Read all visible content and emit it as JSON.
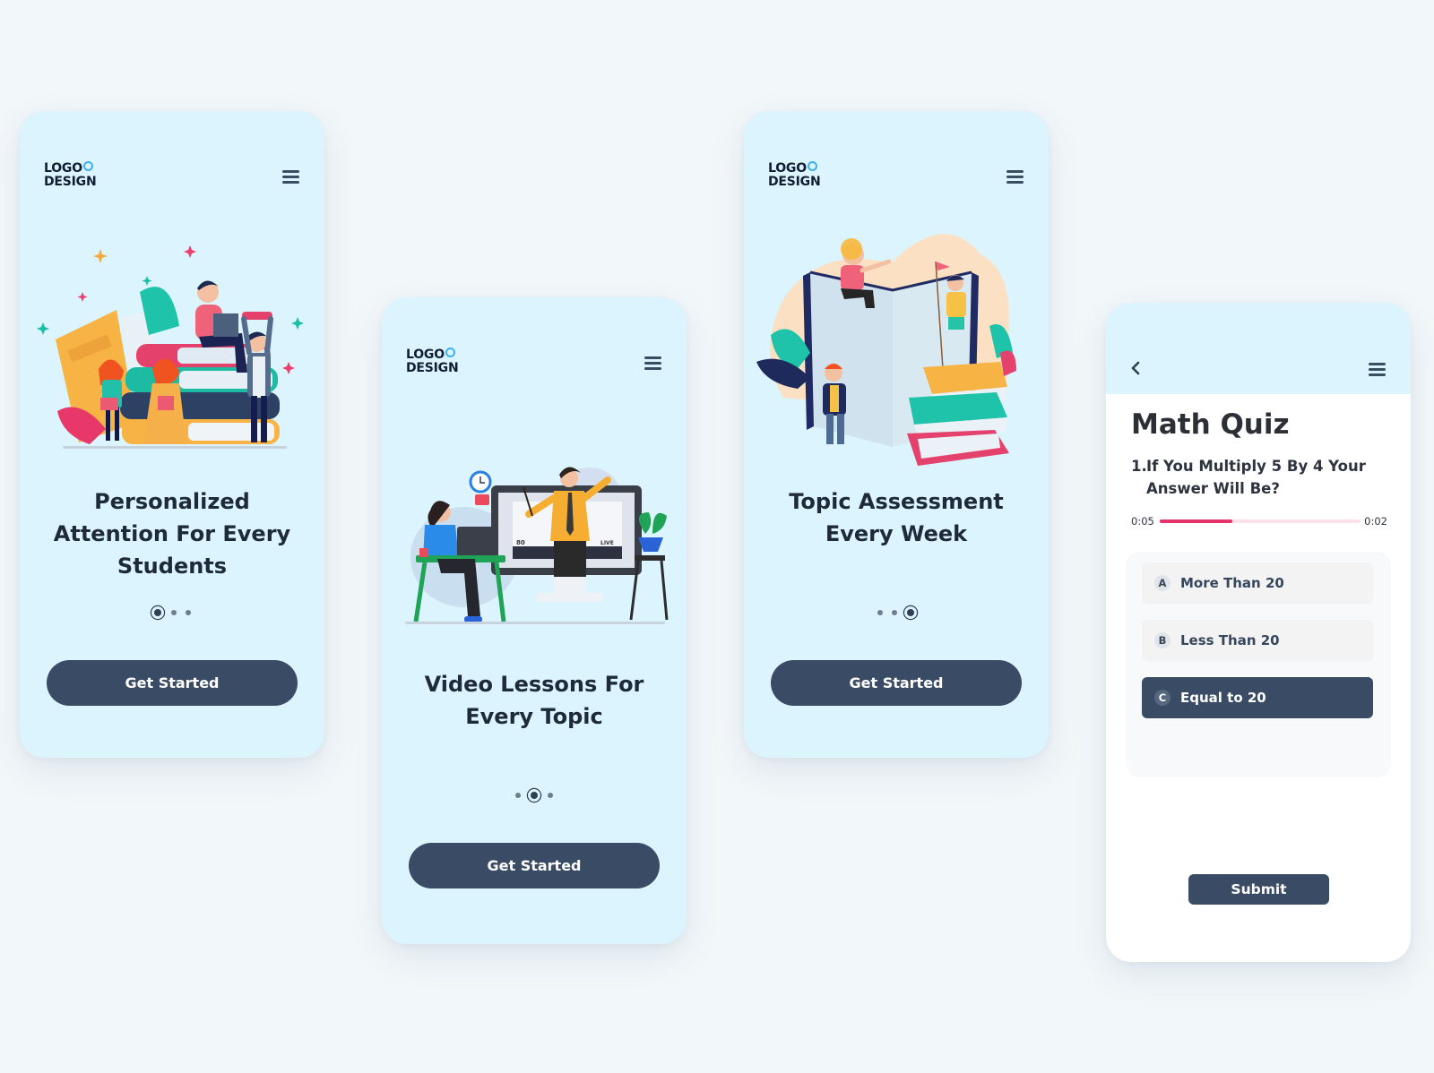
{
  "brand": {
    "logo_line1": "LOGO",
    "logo_line2": "DESIGN",
    "accent": "#3fb1f3"
  },
  "screens": [
    {
      "title": "Personalized Attention For Every Students",
      "illustration": "students-reading-books-illustration",
      "dots_total": 3,
      "dots_active": 1,
      "cta": "Get Started"
    },
    {
      "title": "Video Lessons For Every  Topic",
      "illustration": "online-video-lesson-illustration",
      "dots_total": 3,
      "dots_active": 2,
      "cta": "Get Started",
      "video_overlay": {
        "viewers": "80",
        "live": "LIVE"
      }
    },
    {
      "title": "Topic Assessment Every Week",
      "illustration": "kids-on-giant-book-illustration",
      "dots_total": 3,
      "dots_active": 3,
      "cta": "Get Started"
    }
  ],
  "quiz": {
    "title": "Math Quiz",
    "question_number": "1.",
    "question": "If You Multiply 5 By 4 Your Answer Will Be?",
    "timer_left": "0:05",
    "timer_right": "0:02",
    "progress_fraction": 0.36,
    "options": [
      {
        "letter": "A",
        "label": "More Than 20",
        "selected": false
      },
      {
        "letter": "B",
        "label": "Less Than 20",
        "selected": false
      },
      {
        "letter": "C",
        "label": "Equal  to 20",
        "selected": true
      }
    ],
    "submit_label": "Submit"
  },
  "colors": {
    "primary": "#3a4c65",
    "screen_bg": "#dbf4fd",
    "progress": "#e3336a"
  }
}
